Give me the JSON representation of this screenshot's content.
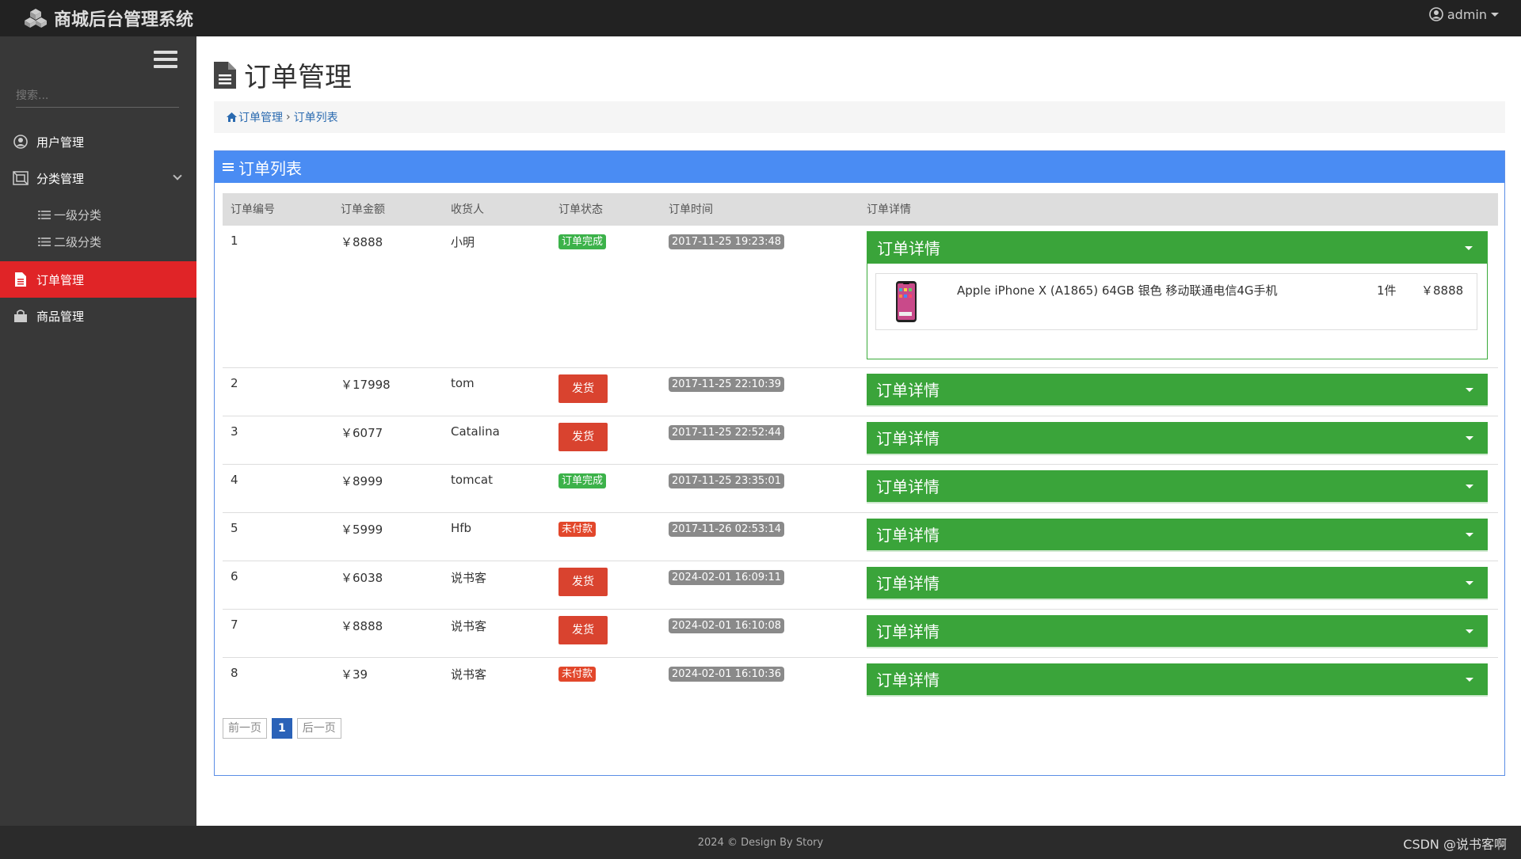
{
  "app": {
    "brand": "商城后台管理系统",
    "user": "admin"
  },
  "sidebar": {
    "search_placeholder": "搜索...",
    "items": [
      {
        "label": "用户管理",
        "icon": "user-circle-icon"
      },
      {
        "label": "分类管理",
        "icon": "category-icon"
      },
      {
        "label": "订单管理",
        "icon": "file-icon"
      },
      {
        "label": "商品管理",
        "icon": "shopping-bag-icon"
      }
    ],
    "sub_items": [
      {
        "label": "一级分类"
      },
      {
        "label": "二级分类"
      }
    ]
  },
  "main": {
    "page_title": "订单管理",
    "breadcrumb": [
      "订单管理",
      "订单列表"
    ],
    "panel_title": "订单列表",
    "columns": [
      "订单编号",
      "订单金额",
      "收货人",
      "订单状态",
      "订单时间",
      "订单详情"
    ],
    "detail_label": "订单详情",
    "orders": [
      {
        "id": "1",
        "amount": "￥8888",
        "receiver": "小明",
        "status": "订单完成",
        "status_type": "done",
        "time": "2017-11-25 19:23:48"
      },
      {
        "id": "2",
        "amount": "￥17998",
        "receiver": "tom",
        "status": "发货",
        "status_type": "ship",
        "time": "2017-11-25 22:10:39"
      },
      {
        "id": "3",
        "amount": "￥6077",
        "receiver": "Catalina",
        "status": "发货",
        "status_type": "ship",
        "time": "2017-11-25 22:52:44"
      },
      {
        "id": "4",
        "amount": "￥8999",
        "receiver": "tomcat",
        "status": "订单完成",
        "status_type": "done",
        "time": "2017-11-25 23:35:01"
      },
      {
        "id": "5",
        "amount": "￥5999",
        "receiver": "Hfb",
        "status": "未付款",
        "status_type": "unpaid",
        "time": "2017-11-26 02:53:14"
      },
      {
        "id": "6",
        "amount": "￥6038",
        "receiver": "说书客",
        "status": "发货",
        "status_type": "ship",
        "time": "2024-02-01 16:09:11"
      },
      {
        "id": "7",
        "amount": "￥8888",
        "receiver": "说书客",
        "status": "发货",
        "status_type": "ship",
        "time": "2024-02-01 16:10:08"
      },
      {
        "id": "8",
        "amount": "￥39",
        "receiver": "说书客",
        "status": "未付款",
        "status_type": "unpaid",
        "time": "2024-02-01 16:10:36"
      }
    ],
    "expanded_item": {
      "name": "Apple iPhone X (A1865) 64GB 银色 移动联通电信4G手机",
      "qty": "1件",
      "price": "￥8888"
    },
    "pager": {
      "prev": "前一页",
      "current": "1",
      "next": "后一页"
    }
  },
  "footer": {
    "text": "2024 © Design By Story",
    "watermark": "CSDN @说书客啊"
  },
  "colors": {
    "accent": "#4a8cf3",
    "active_nav": "#e02427",
    "detail_green": "#3aa43a",
    "ship_red": "#d9432f"
  }
}
